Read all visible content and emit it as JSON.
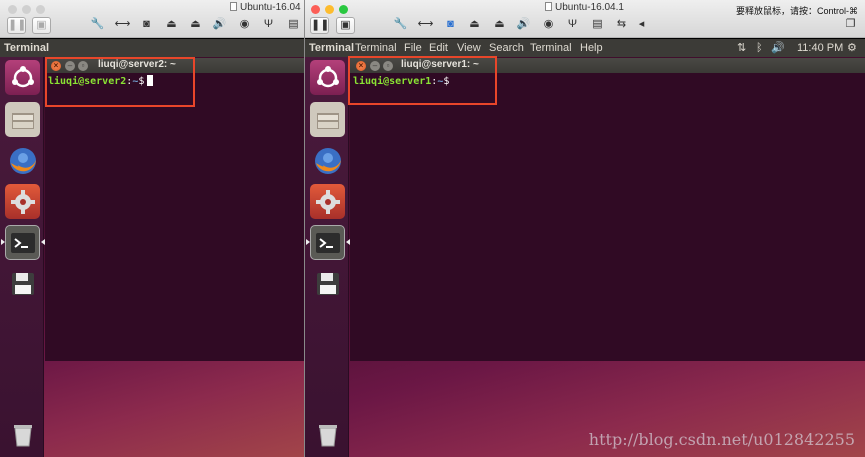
{
  "left": {
    "window_title": "Ubuntu-16.04",
    "panel_app": "Terminal",
    "terminal": {
      "title": "liuqi@server2: ~",
      "prompt_user": "liuqi@server2",
      "prompt_sep": ":",
      "prompt_path": "~",
      "prompt_symbol": "$"
    }
  },
  "right": {
    "window_title": "Ubuntu-16.04.1",
    "release_hint": "要释放鼠标，请按：Control-⌘",
    "panel_app": "Terminal",
    "menu": [
      "Terminal",
      "File",
      "Edit",
      "View",
      "Search",
      "Terminal",
      "Help"
    ],
    "clock": "11:40 PM",
    "terminal": {
      "title": "liuqi@server1: ~",
      "prompt_user": "liuqi@server1",
      "prompt_sep": ":",
      "prompt_path": "~",
      "prompt_symbol": "$"
    }
  },
  "launcher_icons": [
    "ubuntu-dash-icon",
    "files-icon",
    "firefox-icon",
    "system-settings-icon",
    "terminal-icon",
    "save-disk-icon",
    "trash-icon"
  ],
  "toolbar_icons": [
    "pause-icon",
    "snapshot-icon",
    "wrench-icon",
    "arrows-icon",
    "disk-icon",
    "printer-icon",
    "printer2-icon",
    "volume-icon",
    "camera-icon",
    "usb-icon",
    "floppy-icon",
    "share-icon",
    "back-icon"
  ],
  "watermark": "http://blog.csdn.net/u012842255",
  "colors": {
    "terminal_bg": "#300a24",
    "prompt_user": "#8ae234",
    "prompt_path": "#729fcf",
    "highlight": "#e8462a",
    "panel_bg": "#3c3b37"
  }
}
